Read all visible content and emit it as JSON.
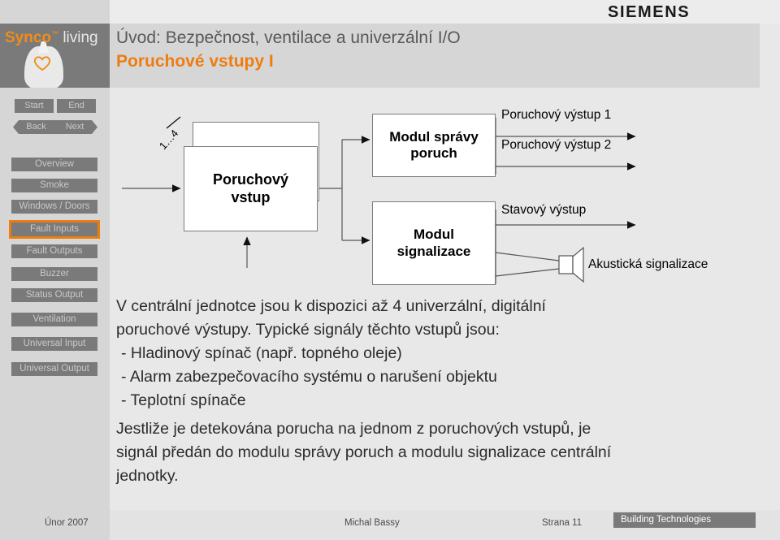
{
  "brand": {
    "siemens": "SIEMENS",
    "logo_synco": "Synco",
    "logo_tm": "™",
    "logo_living": "living",
    "accent_color": "#ee7d11",
    "panel_gray": "#7a7a7a"
  },
  "header": {
    "title": "Úvod: Bezpečnost, ventilace a univerzální I/O",
    "subtitle": "Poruchové vstupy I"
  },
  "sidebar": {
    "nav": [
      {
        "label": "Start",
        "name": "start"
      },
      {
        "label": "End",
        "name": "end"
      },
      {
        "label": "Back",
        "name": "back"
      },
      {
        "label": "Next",
        "name": "next"
      }
    ],
    "items": [
      {
        "label": "Overview",
        "active": false
      },
      {
        "label": "Smoke",
        "active": false
      },
      {
        "label": "Windows / Doors",
        "active": false
      },
      {
        "label": "Fault Inputs",
        "active": true
      },
      {
        "label": "Fault Outputs",
        "active": false
      },
      {
        "label": "Buzzer",
        "active": false
      },
      {
        "label": "Status Output",
        "active": false
      },
      {
        "label": "Ventilation",
        "active": false
      },
      {
        "label": "Universal Input",
        "active": false
      },
      {
        "label": "Universal Output",
        "active": false
      }
    ]
  },
  "diagram": {
    "input_multiplicity": "1…4",
    "block_input": "Poruchový\nvstup",
    "block_input_line1": "Poruchový",
    "block_input_line2": "vstup",
    "block_fault_mgmt_line1": "Modul správy",
    "block_fault_mgmt_line2": "poruch",
    "block_signal_line1": "Modul",
    "block_signal_line2": "signalizace",
    "out_fault_1": "Poruchový výstup 1",
    "out_fault_2": "Poruchový výstup 2",
    "out_status": "Stavový výstup",
    "out_acoustic": "Akustická signalizace"
  },
  "body": {
    "p1_line1": "V centrální jednotce jsou k dispozici až 4 univerzální, digitální",
    "p1_line2": "poruchové výstupy. Typické signály těchto vstupů jsou:",
    "bullet1": "- Hladinový spínač (např. topného oleje)",
    "bullet2": "- Alarm zabezpečovacího systému o narušení objektu",
    "bullet3": "- Teplotní spínače",
    "p2_line1": "Jestliže je detekována porucha na jednom z poruchových vstupů, je",
    "p2_line2": "signál předán do modulu správy poruch a modulu signalizace centrální",
    "p2_line3": "jednotky."
  },
  "footer": {
    "date": "Únor 2007",
    "author": "Michal Bassy",
    "page": "Strana 11",
    "division": "Building Technologies"
  }
}
